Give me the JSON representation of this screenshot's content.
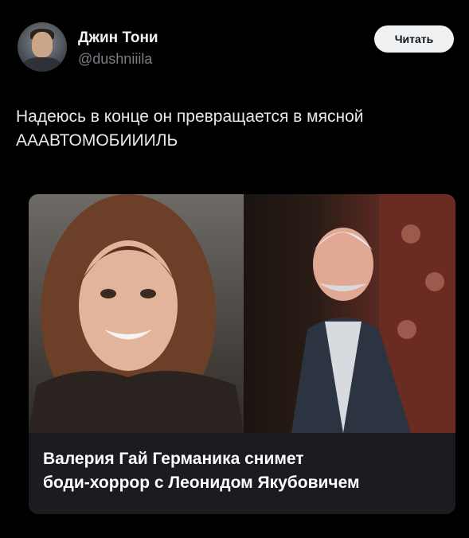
{
  "user": {
    "display_name": "Джин Тони",
    "handle": "@dushniiila"
  },
  "follow_button": {
    "label": "Читать"
  },
  "tweet": {
    "text_line_1": "Надеюсь в конце он превращается в мясной",
    "text_line_2": "АААВТОМОБИИИЛЬ"
  },
  "media": {
    "caption_line_1": "Валерия Гай Германика снимет",
    "caption_line_2": "боди-хоррор с Леонидом Якубовичем"
  },
  "colors": {
    "background": "#000000",
    "handle": "#7b8087",
    "button_bg": "#eff1f2",
    "caption_bg": "#1b1c1f"
  }
}
